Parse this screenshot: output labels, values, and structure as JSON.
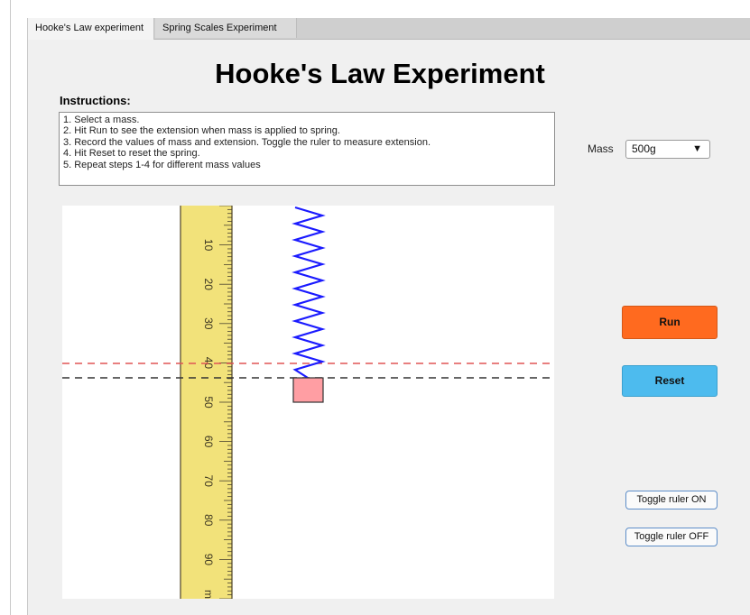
{
  "tabs": [
    {
      "label": "Hooke's Law experiment"
    },
    {
      "label": "Spring Scales Experiment"
    }
  ],
  "title": "Hooke's Law Experiment",
  "instructions": {
    "heading": "Instructions:",
    "lines": [
      "1. Select a mass.",
      "2. Hit Run to see the extension when mass is applied to spring.",
      "3. Record the values of mass and extension. Toggle the ruler to measure extension.",
      "4. Hit Reset to reset the spring.",
      "5. Repeat steps 1-4 for different mass values"
    ]
  },
  "mass": {
    "label": "Mass",
    "selected": "500g"
  },
  "buttons": {
    "run": "Run",
    "reset": "Reset",
    "ruler_on": "Toggle ruler ON",
    "ruler_off": "Toggle ruler OFF"
  },
  "ruler": {
    "labels": [
      "10",
      "20",
      "30",
      "40",
      "50",
      "60",
      "70",
      "80",
      "90"
    ],
    "unit": "mm"
  },
  "colors": {
    "run": "#ff6a1f",
    "reset": "#4dbbee",
    "spring": "#1a1aff",
    "mass_block": "#ff9ea3",
    "ruler": "#f2e27a",
    "reference_line": "#e05555",
    "extension_line": "#333333"
  }
}
